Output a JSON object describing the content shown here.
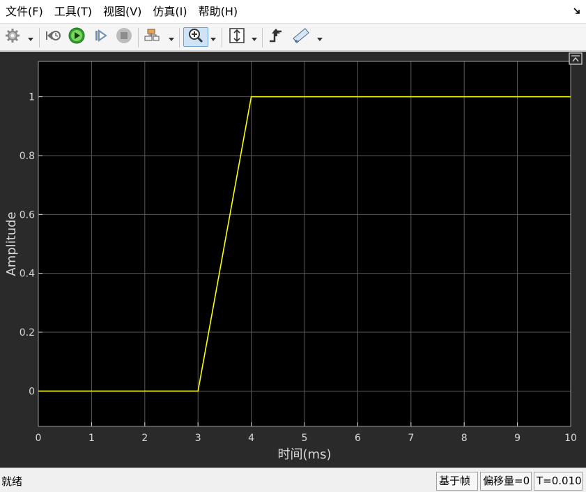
{
  "menu": {
    "file": "文件(F)",
    "tools": "工具(T)",
    "view": "视图(V)",
    "simulation": "仿真(I)",
    "help": "帮助(H)"
  },
  "status": {
    "state": "就绪",
    "mode": "基于帧",
    "offset": "偏移量=0",
    "time": "T=0.010"
  },
  "colors": {
    "signal": "#ffff00",
    "plot_background": "#000000",
    "frame_background": "#2a2a2a",
    "grid": "#5a5a5a",
    "axis_text": "#d9d9d9"
  },
  "chart_data": {
    "type": "line",
    "title": "",
    "xlabel": "时间(ms)",
    "ylabel": "Amplitude",
    "xlim": [
      0,
      10
    ],
    "ylim": [
      -0.12,
      1.12
    ],
    "xticks": [
      "0",
      "1",
      "2",
      "3",
      "4",
      "5",
      "6",
      "7",
      "8",
      "9",
      "10"
    ],
    "yticks": [
      "0",
      "0.2",
      "0.4",
      "0.6",
      "0.8",
      "1"
    ],
    "grid": true,
    "series": [
      {
        "x": [
          0,
          3,
          4,
          10
        ],
        "y": [
          0,
          0,
          1,
          1
        ]
      }
    ]
  }
}
